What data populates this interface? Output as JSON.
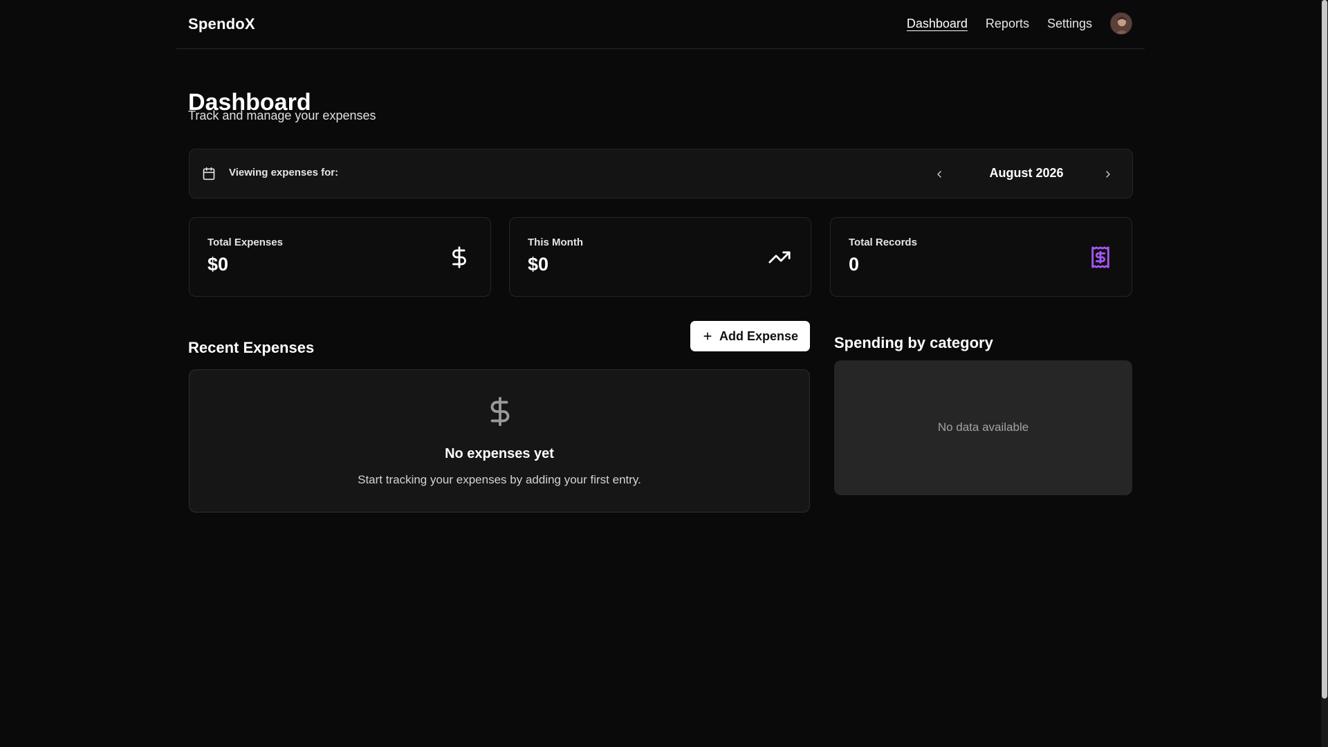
{
  "app": {
    "brand": "SpendoX"
  },
  "nav": {
    "items": [
      {
        "label": "Dashboard",
        "active": true
      },
      {
        "label": "Reports",
        "active": false
      },
      {
        "label": "Settings",
        "active": false
      }
    ],
    "avatar_icon": "user-avatar"
  },
  "header": {
    "title": "Dashboard",
    "subtitle": "Track and manage your expenses"
  },
  "period": {
    "label": "Viewing expenses for:",
    "value": "August 2026",
    "icon": "calendar-icon",
    "prev_icon": "chevron-left-icon",
    "next_icon": "chevron-right-icon"
  },
  "stats": [
    {
      "label": "Total Expenses",
      "value": "$0",
      "icon": "dollar-icon"
    },
    {
      "label": "This Month",
      "value": "$0",
      "icon": "trending-up-icon"
    },
    {
      "label": "Total Records",
      "value": "0",
      "icon": "receipt-icon",
      "icon_color": "#a855f7"
    }
  ],
  "recent": {
    "title": "Recent Expenses",
    "add_button_label": "Add Expense",
    "add_icon": "plus-icon",
    "empty_icon": "dollar-icon",
    "empty_title": "No expenses yet",
    "empty_text": "Start tracking your expenses by adding your first entry."
  },
  "category": {
    "title": "Spending by category",
    "empty_text": "No data available"
  },
  "colors": {
    "background": "#0a0a0a",
    "accent": "#a855f7",
    "card": "#141414"
  }
}
